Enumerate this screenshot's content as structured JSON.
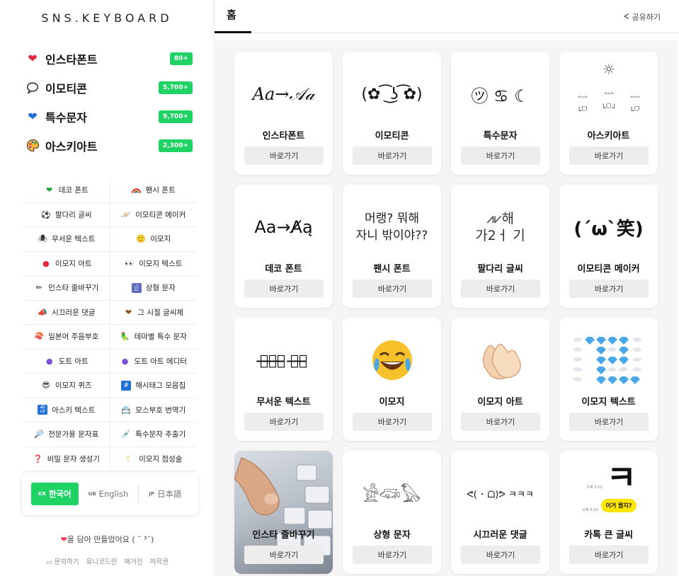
{
  "logo": "SNS.KEYBOARD",
  "main_nav": [
    {
      "label": "인스타폰트",
      "badge": "80+",
      "icon": "heart-icon"
    },
    {
      "label": "이모티콘",
      "badge": "5,700+",
      "icon": "speech-bubble-icon"
    },
    {
      "label": "특수문자",
      "badge": "9,700+",
      "icon": "blue-heart-icon"
    },
    {
      "label": "아스키아트",
      "badge": "2,300+",
      "icon": "palette-icon"
    }
  ],
  "sub_nav": [
    {
      "label": "데코 폰트",
      "icon": "green-heart-icon"
    },
    {
      "label": "팬시 폰트",
      "icon": "rainbow-icon"
    },
    {
      "label": "팔다리 글씨",
      "icon": "soccer-ball-icon"
    },
    {
      "label": "이모티콘 메이커",
      "icon": "planet-icon"
    },
    {
      "label": "무서운 텍스트",
      "icon": "spider-icon"
    },
    {
      "label": "이모지",
      "icon": "smiley-icon"
    },
    {
      "label": "이모지 아트",
      "icon": "lollipop-icon"
    },
    {
      "label": "이모지 텍스트",
      "icon": "eyes-icon"
    },
    {
      "label": "인스타 줄바꾸기",
      "icon": "pencil-icon"
    },
    {
      "label": "상형 문자",
      "icon": "hieroglyph-icon"
    },
    {
      "label": "시끄러운 댓글",
      "icon": "megaphone-icon"
    },
    {
      "label": "그 시절 글씨체",
      "icon": "brown-heart-icon"
    },
    {
      "label": "일본어 주음부호",
      "icon": "sushi-icon"
    },
    {
      "label": "테마별 특수 문자",
      "icon": "bird-icon"
    },
    {
      "label": "도트 아트",
      "icon": "purple-circle-icon"
    },
    {
      "label": "도트 아트 에디터",
      "icon": "purple-circle-icon"
    },
    {
      "label": "이모지 퀴즈",
      "icon": "sunglasses-icon"
    },
    {
      "label": "해시태그 모음집",
      "icon": "hash-icon"
    },
    {
      "label": "아스키 텍스트",
      "icon": "abcd-icon"
    },
    {
      "label": "모스부호 번역기",
      "icon": "card-index-icon"
    },
    {
      "label": "전문가용 문자표",
      "icon": "magnifier-icon"
    },
    {
      "label": "특수문자 추출기",
      "icon": "syringe-icon"
    },
    {
      "label": "비밀 문자 생성기",
      "icon": "question-icon"
    },
    {
      "label": "이모지 점성술",
      "icon": "moon-icon"
    }
  ],
  "languages": [
    {
      "code": "KR",
      "label": "한국어",
      "active": true
    },
    {
      "code": "GB",
      "label": "English",
      "active": false
    },
    {
      "code": "JP",
      "label": "日本語",
      "active": false
    }
  ],
  "made_with": {
    "heart": "❤",
    "text": "을 담아 만들었어요 ( ˘ ³˘)"
  },
  "footer": [
    "문의하기",
    "유니코드란",
    "매거진",
    "저작권"
  ],
  "header": {
    "home": "홈",
    "share": "공유하기"
  },
  "go_label": "바로가기",
  "cards": [
    {
      "title": "인스타폰트",
      "art": "Aa→𝒜𝒶"
    },
    {
      "title": "이모티콘",
      "art": "(✿ ͡ ͜ʖ ͡✿)"
    },
    {
      "title": "특수문자",
      "art": "㋡ ♋ ☾"
    },
    {
      "title": "아스키아트",
      "art": "☀ ^ᐢ^ ^ᐢ^"
    },
    {
      "title": "데코 폰트",
      "art": "Aa→A̸ą"
    },
    {
      "title": "팬시 폰트",
      "art": "머랭? 뭐해\n자니 밖이야??"
    },
    {
      "title": "팔다리 글씨",
      "art": "⩘⩗해\n가2ㅓ 기"
    },
    {
      "title": "이모티콘 메이커",
      "art": "(´ω`笑)"
    },
    {
      "title": "무서운 텍스트",
      "art": "무̶서̶운̶ 글̶씨̶"
    },
    {
      "title": "이모지",
      "art": "😂"
    },
    {
      "title": "이모지 아트",
      "art": "👏"
    },
    {
      "title": "이모지 텍스트",
      "art": "💎💎💎💎💎"
    },
    {
      "title": "인스타 줄바꾸기",
      "art": "⌨"
    },
    {
      "title": "상형 문자",
      "art": "𓀀𓆛𓅃"
    },
    {
      "title": "시끄러운 댓글",
      "art": "ᕙ( ･ ᗝ)ᕗ ㅋㅋㅋ"
    },
    {
      "title": "카톡 큰 글씨",
      "art": "ㅋ",
      "sub": "이거 뭡지?",
      "time1": "오후 3:12",
      "time2": "오후 3:12"
    }
  ]
}
